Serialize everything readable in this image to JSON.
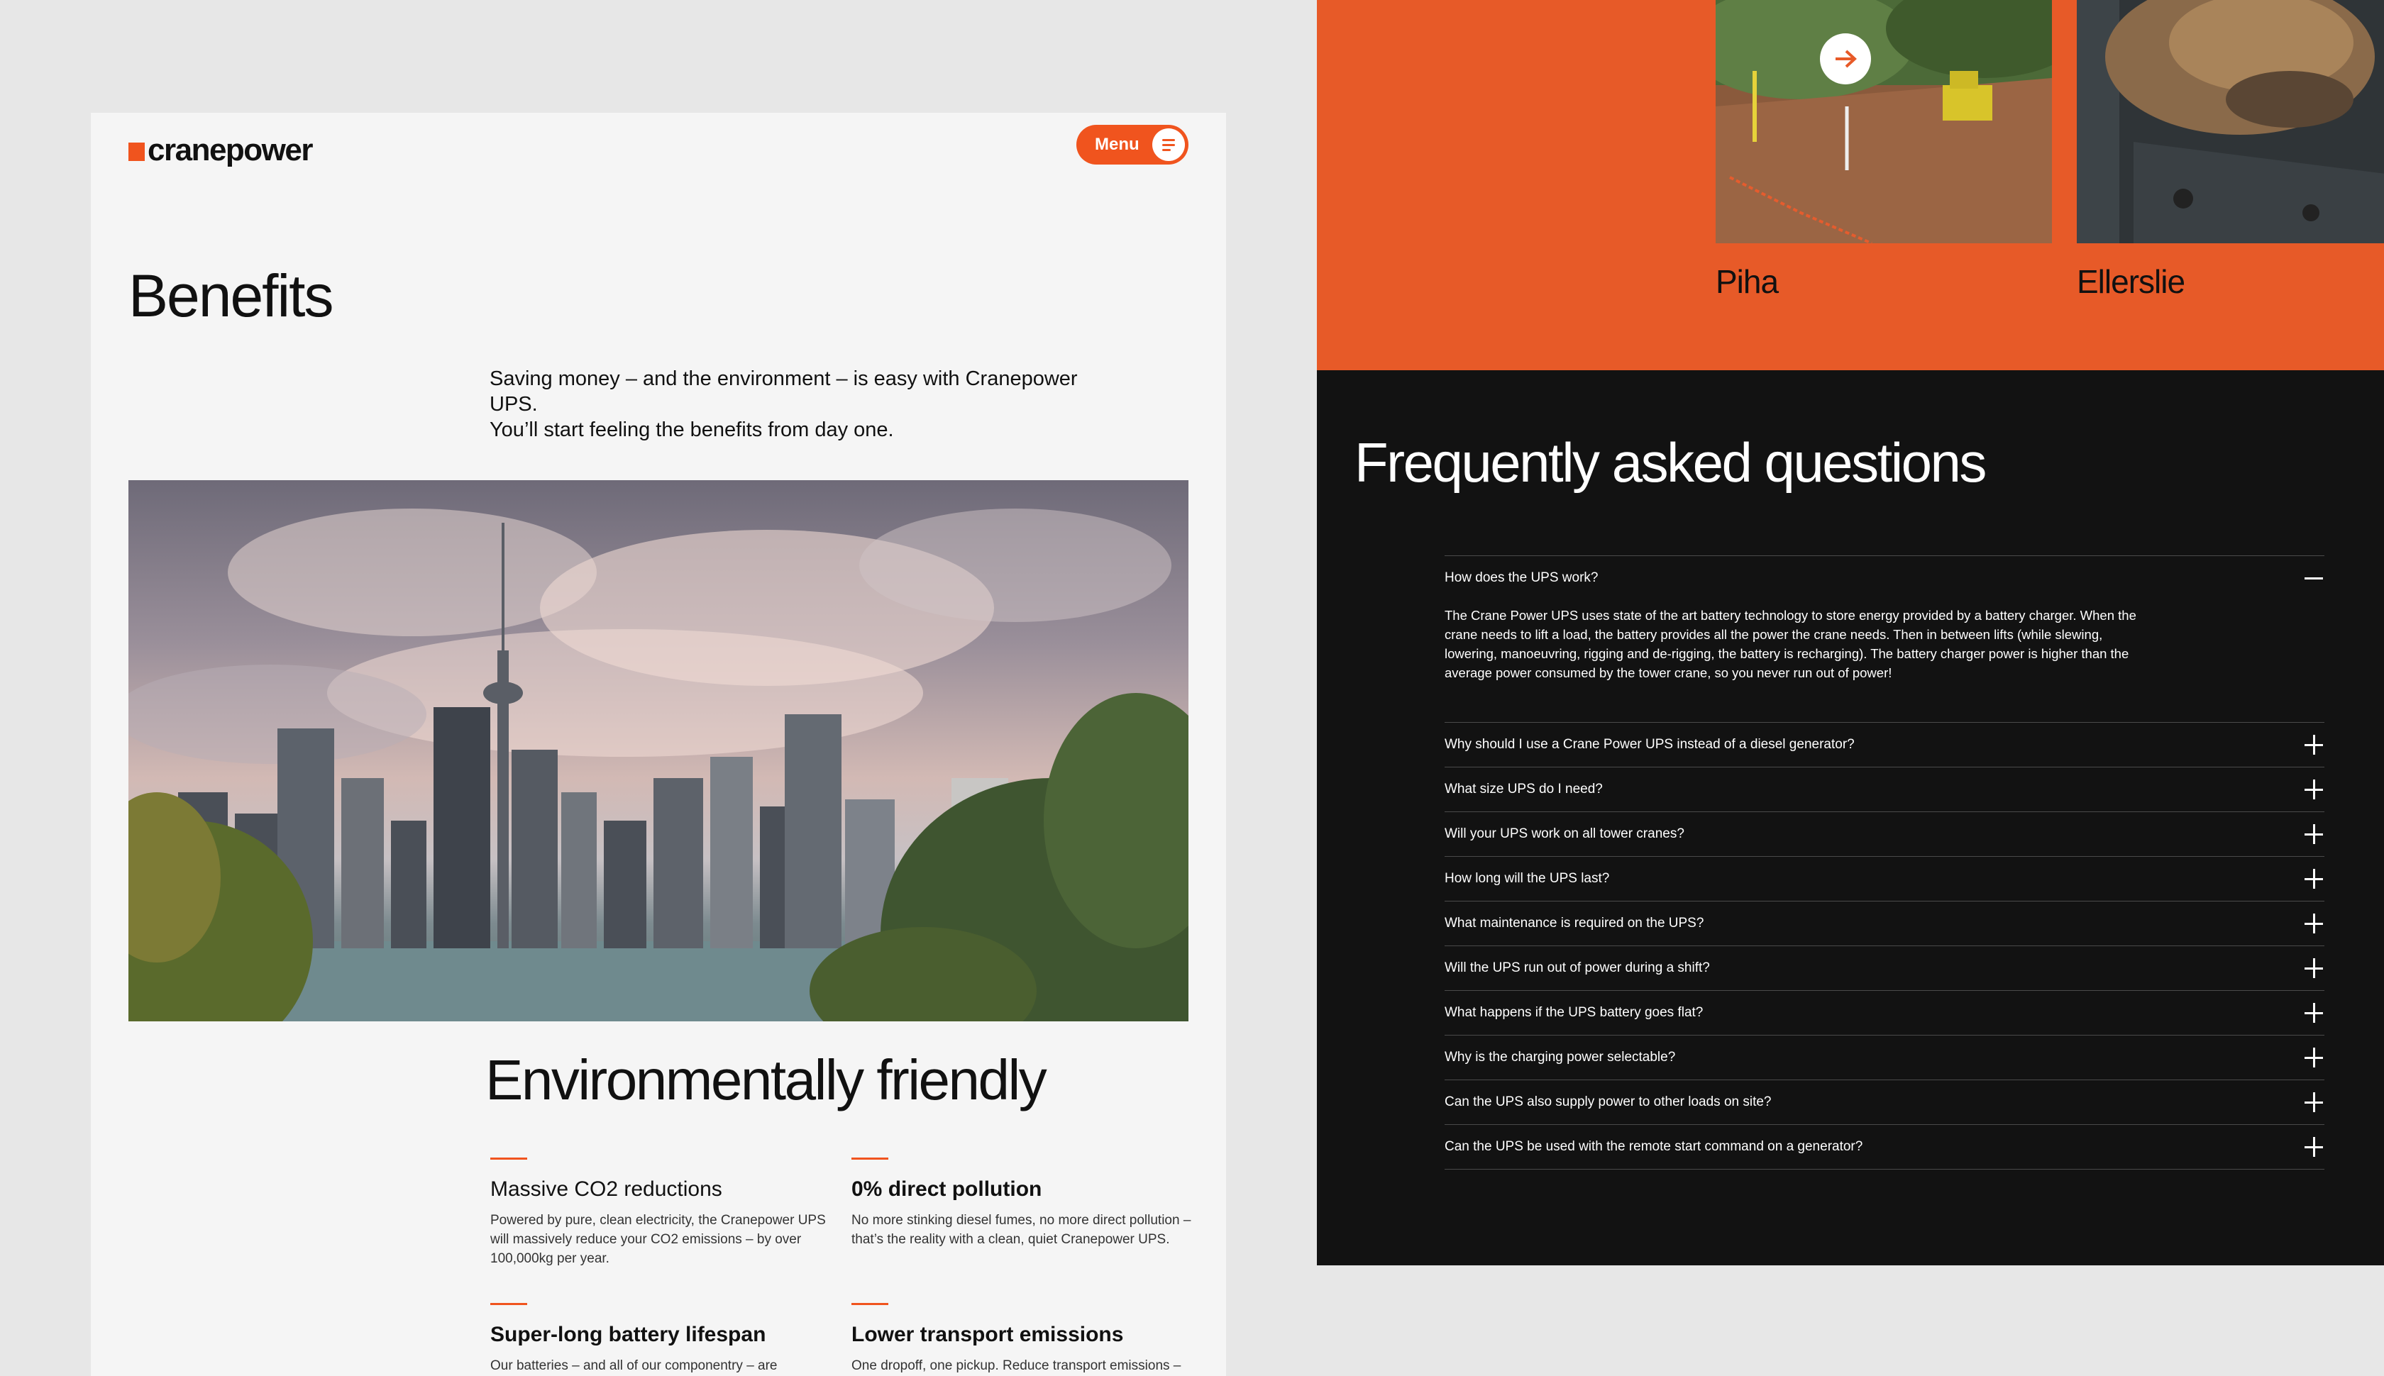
{
  "left": {
    "brand": {
      "name": "cranepower"
    },
    "menu": {
      "label": "Menu",
      "icon": "menu-lines-icon"
    },
    "page_title": "Benefits",
    "intro": {
      "line1": "Saving money – and the environment – is easy with Cranepower UPS.",
      "line2": "You’ll start feeling the benefits from day one."
    },
    "section_title": "Environmentally friendly",
    "features": [
      {
        "title": "Massive CO2 reductions",
        "text": "Powered by pure, clean electricity, the Cranepower UPS will massively reduce your CO2 emissions – by over 100,000kg per year."
      },
      {
        "title": "0% direct pollution",
        "text": "No more stinking diesel fumes, no more direct pollution – that’s the reality with a clean, quiet Cranepower UPS."
      },
      {
        "title": "Super-long battery lifespan",
        "text": "Our batteries – and all of our componentry – are specially"
      },
      {
        "title": "Lower transport emissions",
        "text": "One dropoff, one pickup. Reduce transport emissions –"
      }
    ]
  },
  "right": {
    "locations": [
      {
        "name": "Piha"
      },
      {
        "name": "Ellerslie"
      }
    ],
    "faq": {
      "title": "Frequently asked questions",
      "items": [
        {
          "q": "How does the UPS work?",
          "a": "The Crane Power UPS uses state of the art battery technology to store energy provided by a battery charger. When the crane needs to lift a load, the battery provides all the power the crane needs. Then in between lifts (while slewing, lowering, manoeuvring, rigging and de-rigging, the battery is recharging). The battery charger power is higher than the average power consumed by the tower crane, so you never run out of power!"
        },
        {
          "q": "Why should I use a Crane Power UPS instead of a diesel generator?"
        },
        {
          "q": "What size UPS do I need?"
        },
        {
          "q": "Will your UPS work on all tower cranes?"
        },
        {
          "q": "How long will the UPS last?"
        },
        {
          "q": "What maintenance is required on the UPS?"
        },
        {
          "q": "Will the UPS run out of power during a shift?"
        },
        {
          "q": "What happens if the UPS battery goes flat?"
        },
        {
          "q": "Why is the charging power selectable?"
        },
        {
          "q": "Can the UPS also supply power to other loads on site?"
        },
        {
          "q": "Can the UPS be used with the remote start command on a generator?"
        }
      ]
    }
  },
  "colors": {
    "accent": "#f0541e",
    "band": "#e75a28",
    "dark": "#121212"
  }
}
